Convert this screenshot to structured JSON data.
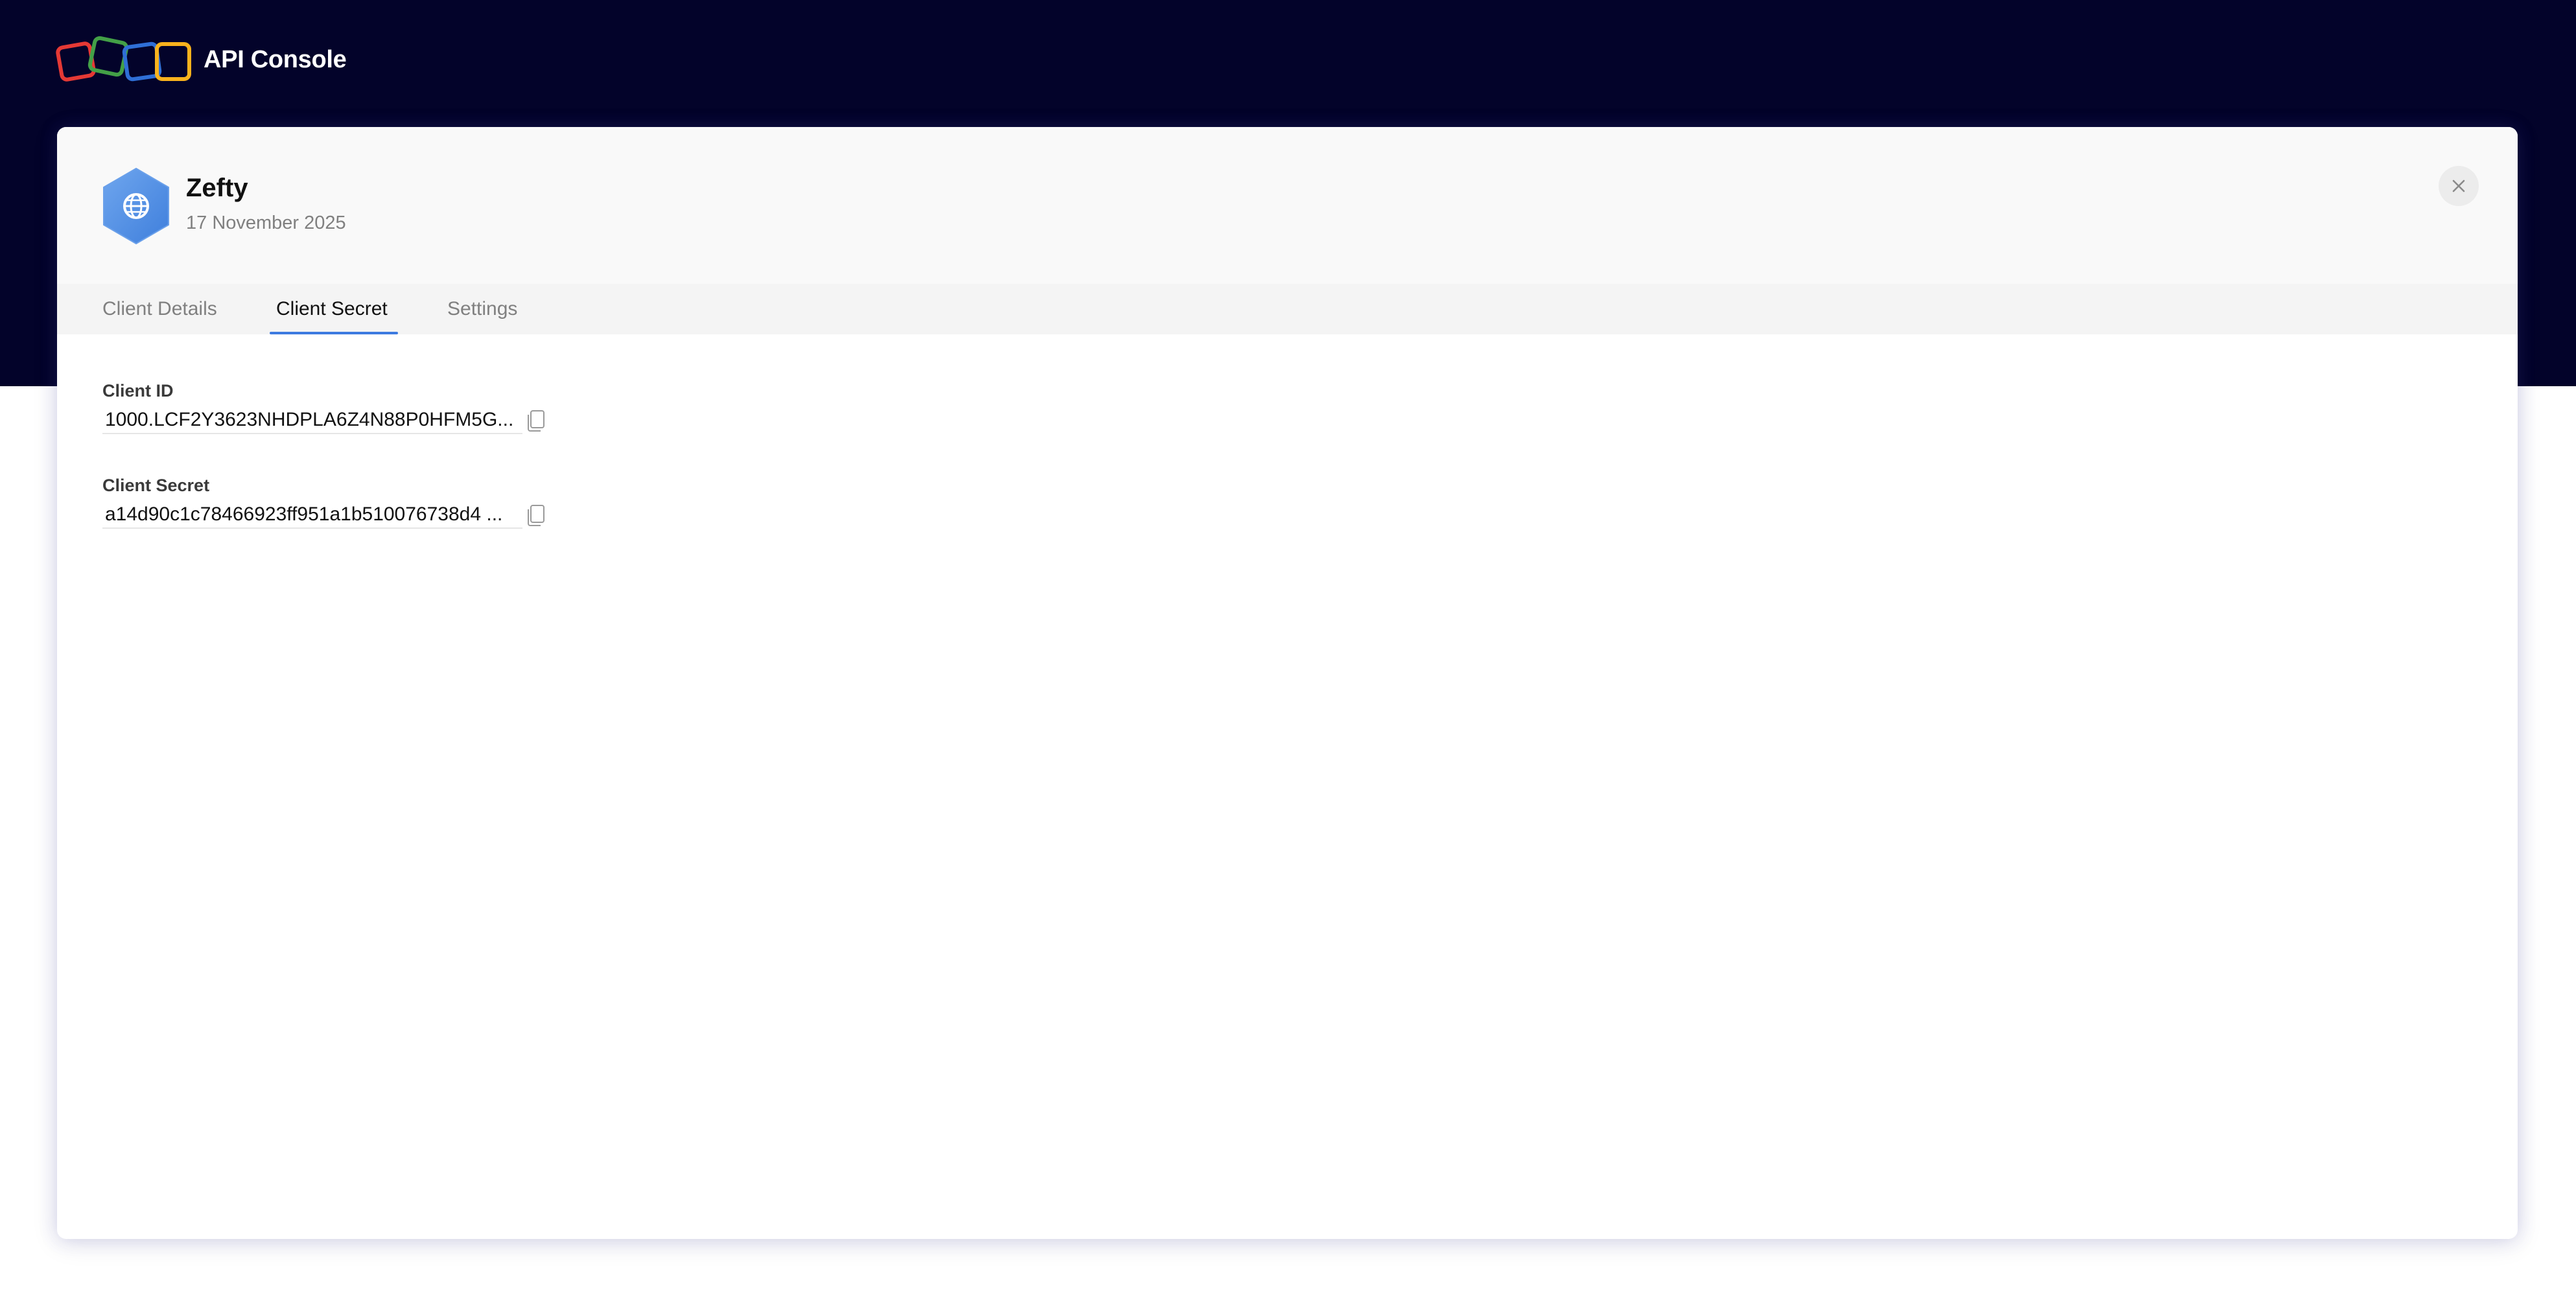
{
  "brand": {
    "title": "API Console",
    "logo_colors": [
      "#e53935",
      "#43a047",
      "#2f6fd6",
      "#f9b21d"
    ]
  },
  "app": {
    "name": "Zefty",
    "date": "17 November 2025",
    "badge_icon": "globe-icon",
    "badge_color": "#4f8fe8"
  },
  "close": {
    "icon": "close-icon"
  },
  "tabs": [
    {
      "label": "Client Details",
      "active": false
    },
    {
      "label": "Client Secret",
      "active": true
    },
    {
      "label": "Settings",
      "active": false
    }
  ],
  "fields": {
    "client_id": {
      "label": "Client ID",
      "value": "1000.LCF2Y3623NHDPLA6Z4N88P0HFM5G...",
      "action_icon": "copy-icon"
    },
    "client_secret": {
      "label": "Client Secret",
      "value": "a14d90c1c78466923ff951a1b510076738d4  ...",
      "action_icon": "copy-icon"
    }
  },
  "colors": {
    "header_band": "#03032a",
    "accent": "#3d7be0"
  }
}
